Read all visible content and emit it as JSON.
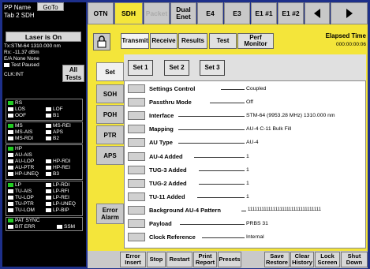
{
  "left": {
    "pp_name": "PP Name",
    "goto_label": "GoTo",
    "tab_name": "Tab 2 SDH",
    "laser_label": "Laser is On",
    "info_lines": [
      "Tx:STM-64 1310.000 nm",
      "Rx: -11.37 dBm",
      "E/A None None"
    ],
    "test_paused": "Test Paused",
    "clk": "CLK:INT",
    "all_tests_1": "All",
    "all_tests_2": "Tests",
    "alarms": {
      "g1": [
        "RS",
        "LOS",
        "LOF",
        "OOF",
        "B1"
      ],
      "g2": [
        "MS",
        "MS-REI",
        "MS-AIS",
        "APS",
        "MS-RDI",
        "B2"
      ],
      "g3": [
        "HP",
        "AU-AIS",
        "AU-LOP",
        "HP-RDI",
        "AU-PTR",
        "HP-REI",
        "HP-UNEQ",
        "B3"
      ],
      "g4": [
        "LP",
        "LP-RDI",
        "TU-AIS",
        "LP-RFI",
        "TU-LOP",
        "LP-REI",
        "TU-PTR",
        "LP-UNEQ",
        "TU-LOM",
        "LP-BIP"
      ],
      "g5": [
        "PAT SYNC",
        "BIT ERR",
        "SSM"
      ]
    }
  },
  "tabs": [
    "OTN",
    "SDH",
    "Packet",
    "Dual Enet",
    "E4",
    "E3",
    "E1 #1",
    "E1 #2"
  ],
  "subtabs": [
    "Transmit",
    "Receive",
    "Results",
    "Test",
    "Perf Monitor"
  ],
  "elapsed": {
    "title": "Elapsed Time",
    "value": "000:00:00:06"
  },
  "side_tabs": [
    "Set",
    "SOH",
    "POH",
    "PTR",
    "APS",
    "Error Alarm"
  ],
  "sets": [
    "Set 1",
    "Set 2",
    "Set 3"
  ],
  "rows": [
    {
      "label": "Settings Control",
      "value": "Coupled"
    },
    {
      "label": "Passthru Mode",
      "value": "Off"
    },
    {
      "label": "Interface",
      "value": "STM-64 (9953.28 MHz) 1310.000 nm"
    },
    {
      "label": "Mapping",
      "value": "AU-4 C-11 Bulk Fill"
    },
    {
      "label": "AU Type",
      "value": "AU-4"
    },
    {
      "label": "AU-4 Added",
      "value": "1"
    },
    {
      "label": "TUG-3 Added",
      "value": "1"
    },
    {
      "label": "TUG-2 Added",
      "value": "1"
    },
    {
      "label": "TU-11 Added",
      "value": "1"
    },
    {
      "label": "Background AU-4 Pattern",
      "value": "11111111111111111111111111111111"
    },
    {
      "label": "Payload",
      "value": "PRBS 31"
    },
    {
      "label": "Clock Reference",
      "value": "Internal"
    }
  ],
  "bottom": [
    "Error Insert",
    "Stop",
    "Restart",
    "Print Report",
    "Presets",
    "Save Restore",
    "Clear History",
    "Lock Screen",
    "Shut Down"
  ]
}
